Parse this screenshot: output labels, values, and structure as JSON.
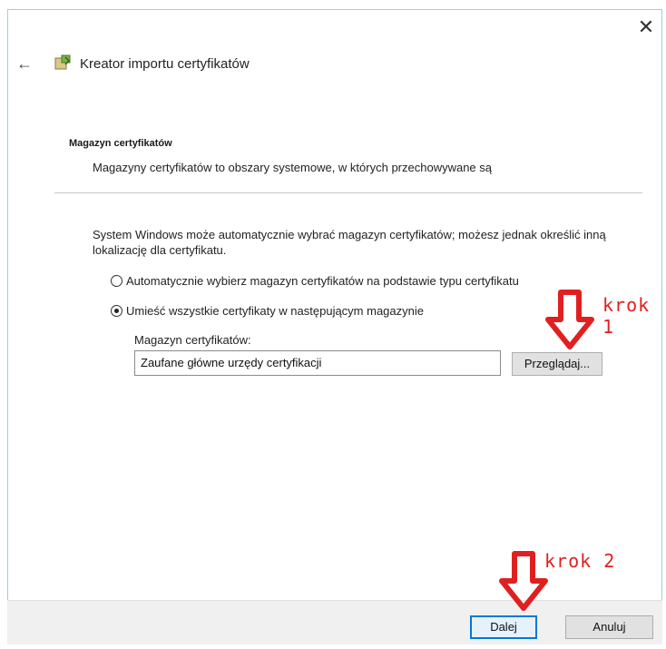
{
  "window": {
    "close_glyph": "✕",
    "back_glyph": "←"
  },
  "wizard": {
    "title": "Kreator importu certyfikatów",
    "icon": "certificate-import-icon"
  },
  "section": {
    "title": "Magazyn certyfikatów",
    "description": "Magazyny certyfikatów to obszary systemowe, w których przechowywane są"
  },
  "intro": "System Windows może automatycznie wybrać magazyn certyfikatów; możesz jednak określić inną lokalizację dla certyfikatu.",
  "options": {
    "auto": "Automatycznie wybierz magazyn certyfikatów na podstawie typu certyfikatu",
    "manual": "Umieść wszystkie certyfikaty w następującym magazynie",
    "selected": "manual"
  },
  "store": {
    "label": "Magazyn certyfikatów:",
    "value": "Zaufane główne urzędy certyfikacji",
    "browse_label": "Przeglądaj..."
  },
  "footer": {
    "next_label": "Dalej",
    "cancel_label": "Anuluj"
  },
  "annotations": {
    "step1": "krok 1",
    "step2": "krok 2",
    "color": "#e02020"
  }
}
